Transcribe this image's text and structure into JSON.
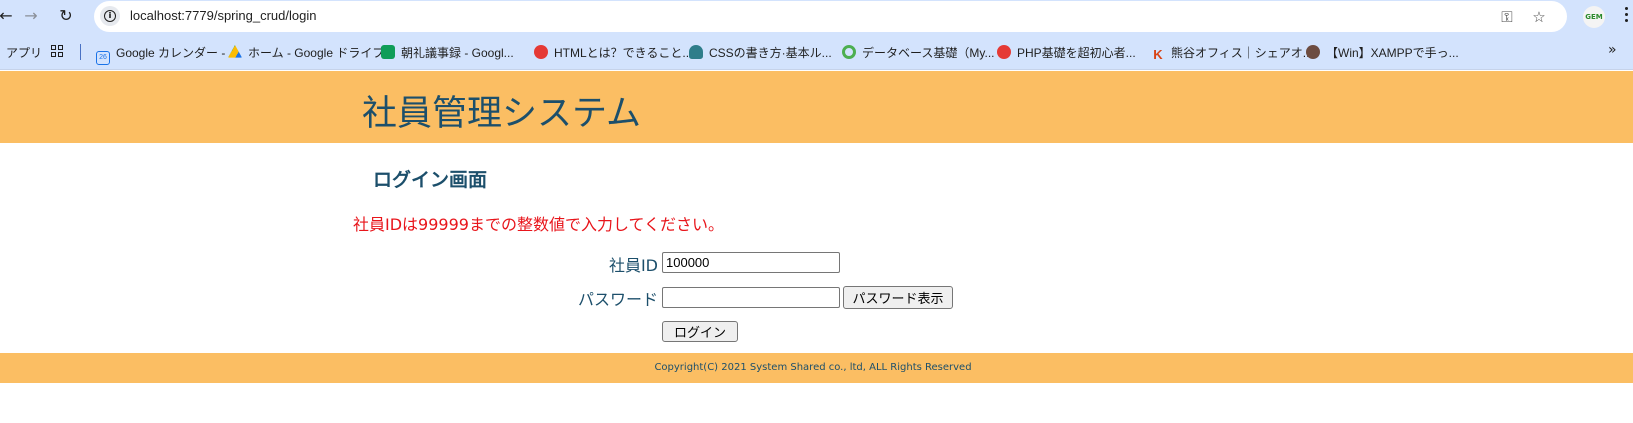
{
  "browser": {
    "url": "localhost:7779/spring_crud/login",
    "profile_badge": "GEM",
    "bookmarks": [
      {
        "label": "アプリ"
      },
      {
        "label": "Google カレンダー -",
        "icon": "calendar-icon",
        "color": "#1a73e8"
      },
      {
        "label": "ホーム - Google ドライブ",
        "icon": "drive-icon",
        "color": "#fbbc04"
      },
      {
        "label": "朝礼議事録 - Googl...",
        "icon": "sheets-icon",
        "color": "#0f9d58"
      },
      {
        "label": "HTMLとは？できること...",
        "icon": "swirl-icon",
        "color": "#e53935"
      },
      {
        "label": "CSSの書き方·基本ル...",
        "icon": "eyes-icon",
        "color": "#2e7d8a"
      },
      {
        "label": "データベース基礎（My...",
        "icon": "q-icon",
        "color": "#4caf50"
      },
      {
        "label": "PHP基礎を超初心者...",
        "icon": "swirl-icon",
        "color": "#e53935"
      },
      {
        "label": "熊谷オフィス｜シェアオ...",
        "icon": "k-icon",
        "color": "#d84315"
      },
      {
        "label": "【Win】XAMPPで手っ...",
        "icon": "avatar-icon",
        "color": "#6d4c41"
      }
    ]
  },
  "header": {
    "title": "社員管理システム"
  },
  "main": {
    "page_title": "ログイン画面",
    "error_message": "社員IDは99999までの整数値で入力してください。",
    "employee_id_label": "社員ID",
    "employee_id_value": "100000",
    "password_label": "パスワード",
    "password_value": "",
    "show_password_button": "パスワード表示",
    "login_button": "ログイン"
  },
  "footer": {
    "copyright": "Copyright(C) 2021 System Shared co., ltd, ALL Rights Reserved"
  },
  "colors": {
    "accent": "#fbbe63",
    "text": "#1c4f6b",
    "error": "#e8151b",
    "chrome": "#d3e3fd"
  }
}
